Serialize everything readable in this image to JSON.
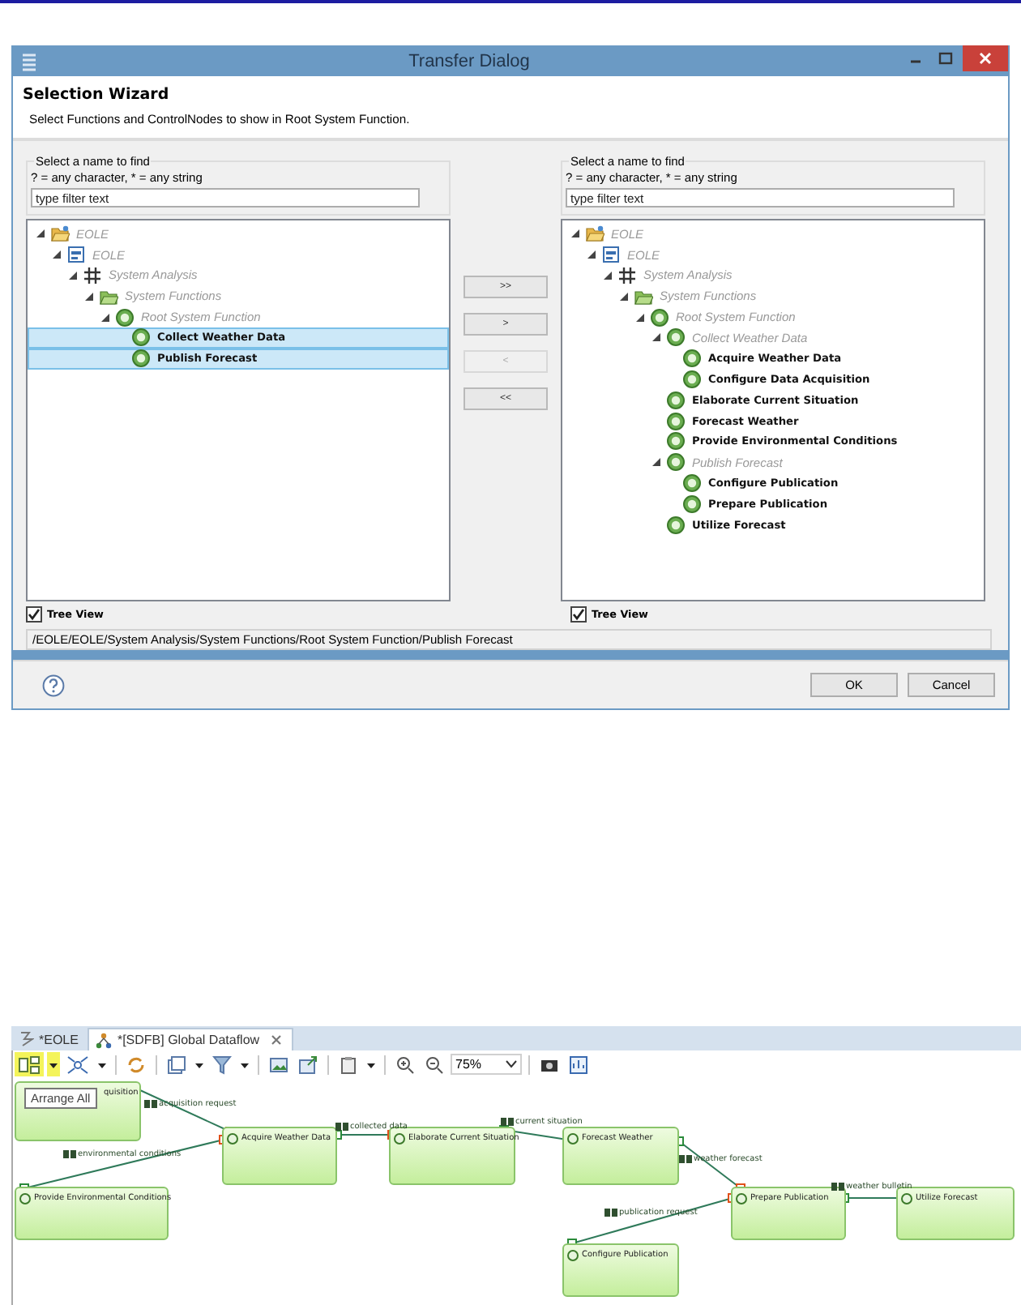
{
  "dialog": {
    "title": "Transfer Dialog",
    "header_title": "Selection Wizard",
    "header_description": "Select Functions and ControlNodes to show in Root System Function.",
    "panes": [
      {
        "group_label": "Select a name to find",
        "hint": "? = any character, * = any string",
        "filter_placeholder": "type filter text",
        "tree_view_label": "Tree View",
        "tree_view_checked": true,
        "tree": [
          {
            "label": "EOLE",
            "kind": "model",
            "context": true,
            "selected": false,
            "expanded": true,
            "children": [
              {
                "label": "EOLE",
                "kind": "project",
                "context": true,
                "selected": false,
                "expanded": true,
                "children": [
                  {
                    "label": "System Analysis",
                    "kind": "package",
                    "context": true,
                    "selected": false,
                    "expanded": true,
                    "children": [
                      {
                        "label": "System Functions",
                        "kind": "folder",
                        "context": true,
                        "selected": false,
                        "expanded": true,
                        "children": [
                          {
                            "label": "Root System Function",
                            "kind": "function",
                            "context": true,
                            "selected": false,
                            "expanded": true,
                            "children": [
                              {
                                "label": "Collect Weather Data",
                                "kind": "function",
                                "context": false,
                                "selected": true
                              },
                              {
                                "label": "Publish Forecast",
                                "kind": "function",
                                "context": false,
                                "selected": true
                              }
                            ]
                          }
                        ]
                      }
                    ]
                  }
                ]
              }
            ]
          }
        ]
      },
      {
        "group_label": "Select a name to find",
        "hint": "? = any character, * = any string",
        "filter_placeholder": "type filter text",
        "tree_view_label": "Tree View",
        "tree_view_checked": true,
        "tree": [
          {
            "label": "EOLE",
            "kind": "model",
            "context": true,
            "selected": false,
            "expanded": true,
            "children": [
              {
                "label": "EOLE",
                "kind": "project",
                "context": true,
                "selected": false,
                "expanded": true,
                "children": [
                  {
                    "label": "System Analysis",
                    "kind": "package",
                    "context": true,
                    "selected": false,
                    "expanded": true,
                    "children": [
                      {
                        "label": "System Functions",
                        "kind": "folder",
                        "context": true,
                        "selected": false,
                        "expanded": true,
                        "children": [
                          {
                            "label": "Root System Function",
                            "kind": "function",
                            "context": true,
                            "selected": false,
                            "expanded": true,
                            "children": [
                              {
                                "label": "Collect Weather Data",
                                "kind": "function",
                                "context": true,
                                "selected": false,
                                "expanded": true,
                                "children": [
                                  {
                                    "label": "Acquire Weather Data",
                                    "kind": "function",
                                    "context": false,
                                    "selected": false
                                  },
                                  {
                                    "label": "Configure Data Acquisition",
                                    "kind": "function",
                                    "context": false,
                                    "selected": false
                                  }
                                ]
                              },
                              {
                                "label": "Elaborate Current Situation",
                                "kind": "function",
                                "context": false,
                                "selected": false
                              },
                              {
                                "label": "Forecast Weather",
                                "kind": "function",
                                "context": false,
                                "selected": false
                              },
                              {
                                "label": "Provide Environmental Conditions",
                                "kind": "function",
                                "context": false,
                                "selected": false
                              },
                              {
                                "label": "Publish Forecast",
                                "kind": "function",
                                "context": true,
                                "selected": false,
                                "expanded": true,
                                "children": [
                                  {
                                    "label": "Configure Publication",
                                    "kind": "function",
                                    "context": false,
                                    "selected": false
                                  },
                                  {
                                    "label": "Prepare Publication",
                                    "kind": "function",
                                    "context": false,
                                    "selected": false
                                  }
                                ]
                              },
                              {
                                "label": "Utilize Forecast",
                                "kind": "function",
                                "context": false,
                                "selected": false
                              }
                            ]
                          }
                        ]
                      }
                    ]
                  }
                ]
              }
            ]
          }
        ]
      }
    ],
    "transfer_buttons": [
      {
        "label": ">>",
        "disabled": false
      },
      {
        "label": ">",
        "disabled": false
      },
      {
        "label": "<",
        "disabled": true
      },
      {
        "label": "<<",
        "disabled": false
      }
    ],
    "path": "/EOLE/EOLE/System Analysis/System Functions/Root System Function/Publish Forecast",
    "buttons": [
      "OK",
      "Cancel"
    ]
  },
  "editor": {
    "tabs": [
      {
        "label": "*EOLE",
        "selected": false
      },
      {
        "label": "*[SDFB] Global Dataflow",
        "selected": true
      }
    ],
    "zoom": "75%",
    "tooltip": "Arrange All",
    "nodes": [
      {
        "label": "quisition"
      },
      {
        "label": "Acquire Weather Data"
      },
      {
        "label": "Elaborate Current Situation"
      },
      {
        "label": "Forecast Weather"
      },
      {
        "label": "Provide Environmental Conditions"
      },
      {
        "label": "Prepare Publication"
      },
      {
        "label": "Utilize Forecast"
      },
      {
        "label": "Configure Publication"
      }
    ],
    "edges": [
      {
        "label": "acquisition request"
      },
      {
        "label": "collected data"
      },
      {
        "label": "current situation"
      },
      {
        "label": "environmental conditions"
      },
      {
        "label": "weather forecast"
      },
      {
        "label": "publication request"
      },
      {
        "label": "weather bulletin"
      }
    ]
  }
}
